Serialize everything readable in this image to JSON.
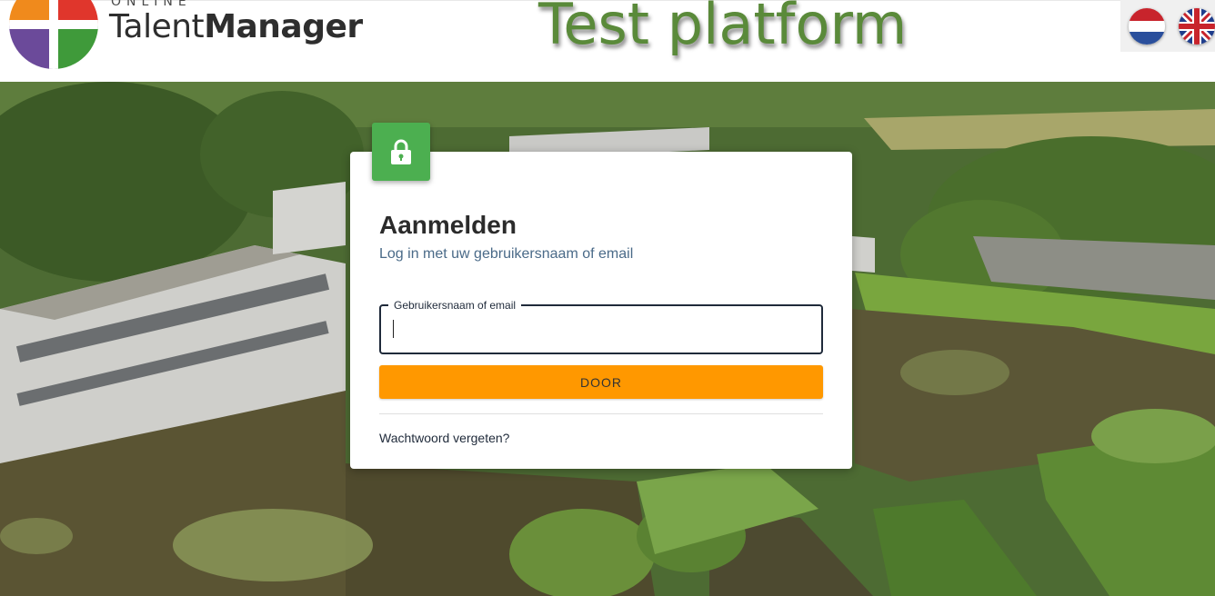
{
  "header": {
    "logo_small_text": "ONLINE",
    "logo_name_light": "Talent",
    "logo_name_bold": "Manager",
    "environment_label": "Test platform",
    "languages": [
      {
        "code": "nl",
        "icon": "netherlands-flag-icon"
      },
      {
        "code": "en",
        "icon": "united-kingdom-flag-icon"
      }
    ]
  },
  "login": {
    "badge_icon": "lock-icon",
    "title": "Aanmelden",
    "subtitle": "Log in met uw gebruikersnaam of email",
    "username_label": "Gebruikersnaam of email",
    "username_value": "",
    "submit_label": "DOOR",
    "forgot_password": "Wachtwoord vergeten?"
  },
  "colors": {
    "lock_badge": "#4caf50",
    "submit_button": "#ff9800",
    "environment_label": "#5a8a3a",
    "field_border": "#1f2a3a"
  }
}
